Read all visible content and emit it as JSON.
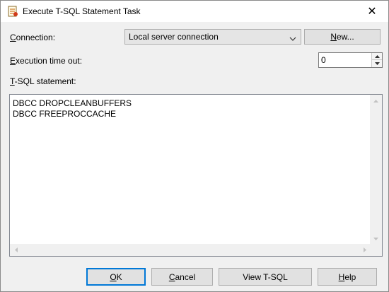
{
  "window": {
    "title": "Execute T-SQL Statement Task",
    "close_glyph": "✕"
  },
  "form": {
    "connection_label_first": "C",
    "connection_label_rest": "onnection:",
    "connection_value": "Local server connection",
    "new_button_first": "N",
    "new_button_rest": "ew...",
    "timeout_label_first": "E",
    "timeout_label_rest": "xecution time out:",
    "timeout_value": "0",
    "statement_label_first": "T",
    "statement_label_rest": "-SQL statement:",
    "statement_text": "DBCC DROPCLEANBUFFERS\nDBCC FREEPROCCACHE"
  },
  "footer": {
    "ok_first": "O",
    "ok_rest": "K",
    "cancel_first": "C",
    "cancel_rest": "ancel",
    "view_tsql": "View T-SQL",
    "help_first": "H",
    "help_rest": "elp"
  },
  "icons": {
    "title": "task-script-icon",
    "close": "close-icon",
    "combo_arrow": "chevron-down-icon",
    "spin_up": "spin-up-icon",
    "spin_down": "spin-down-icon"
  },
  "colors": {
    "accent": "#0078d7",
    "window_bg": "#f0f0f0",
    "button_bg": "#e1e1e1"
  }
}
